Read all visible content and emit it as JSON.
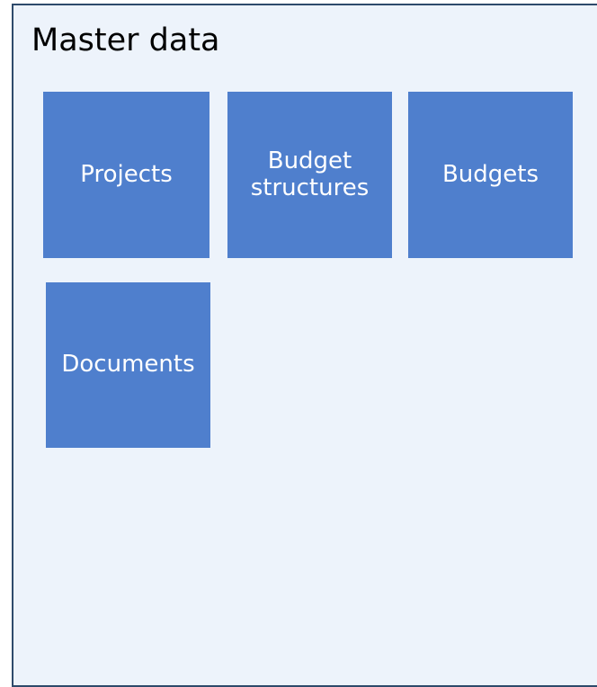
{
  "panel": {
    "title": "Master data"
  },
  "tiles": [
    {
      "label": "Projects"
    },
    {
      "label": "Budget structures"
    },
    {
      "label": "Budgets"
    },
    {
      "label": "Documents"
    }
  ],
  "colors": {
    "panel_background": "#edf3fb",
    "panel_border": "#2e4a6b",
    "tile_background": "#4f7fcd",
    "tile_text": "#ffffff"
  }
}
